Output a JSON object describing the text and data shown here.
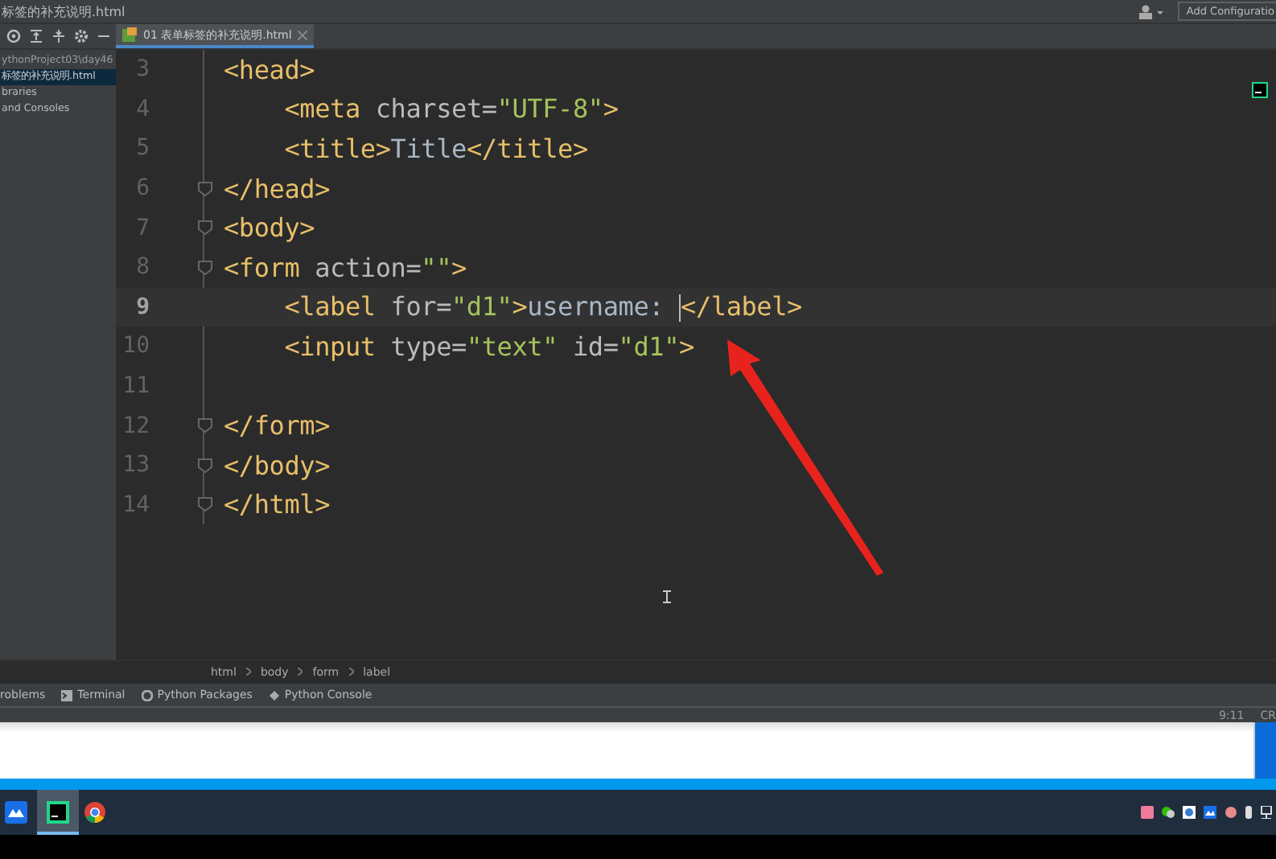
{
  "window": {
    "title": "标签的补充说明.html",
    "run_config": "Add Configuratio"
  },
  "project": {
    "path": "ythonProject03\\day46",
    "items": [
      {
        "label": "标签的补充说明.html",
        "selected": true
      },
      {
        "label": "braries",
        "selected": false
      },
      {
        "label": "and Consoles",
        "selected": false
      }
    ]
  },
  "tabs": [
    {
      "label": "01 表单标签的补充说明.html",
      "selected": true
    }
  ],
  "editor": {
    "lines": [
      {
        "number": "3",
        "fold": false,
        "current": false,
        "tokens": [
          {
            "kind": "tag",
            "text": "<head>"
          }
        ]
      },
      {
        "number": "4",
        "fold": false,
        "current": false,
        "tokens": [
          {
            "kind": "tag",
            "text": "    <meta "
          },
          {
            "kind": "attr",
            "text": "charset="
          },
          {
            "kind": "value",
            "text": "\"UTF-8\""
          },
          {
            "kind": "tag",
            "text": ">"
          }
        ]
      },
      {
        "number": "5",
        "fold": false,
        "current": false,
        "tokens": [
          {
            "kind": "tag",
            "text": "    <title>"
          },
          {
            "kind": "text",
            "text": "Title"
          },
          {
            "kind": "tag",
            "text": "</title>"
          }
        ]
      },
      {
        "number": "6",
        "fold": true,
        "current": false,
        "tokens": [
          {
            "kind": "tag",
            "text": "</head>"
          }
        ]
      },
      {
        "number": "7",
        "fold": true,
        "current": false,
        "tokens": [
          {
            "kind": "tag",
            "text": "<body>"
          }
        ]
      },
      {
        "number": "8",
        "fold": true,
        "current": false,
        "tokens": [
          {
            "kind": "tag",
            "text": "<form "
          },
          {
            "kind": "attr",
            "text": "action="
          },
          {
            "kind": "value",
            "text": "\"\""
          },
          {
            "kind": "tag",
            "text": ">"
          }
        ]
      },
      {
        "number": "9",
        "fold": false,
        "current": true,
        "tokens": [
          {
            "kind": "tag",
            "text": "    <label "
          },
          {
            "kind": "attr",
            "text": "for="
          },
          {
            "kind": "value",
            "text": "\"d1\""
          },
          {
            "kind": "tag",
            "text": ">"
          },
          {
            "kind": "text",
            "text": "username: ",
            "caret_after": true
          },
          {
            "kind": "tag",
            "text": "</label>"
          }
        ]
      },
      {
        "number": "10",
        "fold": false,
        "current": false,
        "tokens": [
          {
            "kind": "tag",
            "text": "    <input "
          },
          {
            "kind": "attr",
            "text": "type="
          },
          {
            "kind": "value",
            "text": "\"text\" "
          },
          {
            "kind": "attr",
            "text": "id="
          },
          {
            "kind": "value",
            "text": "\"d1\""
          },
          {
            "kind": "tag",
            "text": ">"
          }
        ]
      },
      {
        "number": "11",
        "fold": false,
        "current": false
      },
      {
        "number": "12",
        "fold": true,
        "current": false,
        "tokens": [
          {
            "kind": "tag",
            "text": "</form>"
          }
        ]
      },
      {
        "number": "13",
        "fold": true,
        "current": false,
        "tokens": [
          {
            "kind": "tag",
            "text": "</body>"
          }
        ]
      },
      {
        "number": "14",
        "fold": true,
        "current": false,
        "tokens": [
          {
            "kind": "tag",
            "text": "</html>"
          }
        ]
      }
    ]
  },
  "breadcrumbs": [
    "html",
    "body",
    "form",
    "label"
  ],
  "tool_tabs": [
    {
      "label": "roblems",
      "kind": "plain"
    },
    {
      "label": "Terminal",
      "kind": "terminal"
    },
    {
      "label": "Python Packages",
      "kind": "packages"
    },
    {
      "label": "Python Console",
      "kind": "console"
    }
  ],
  "status_bar": {
    "position": "9:11",
    "line_ending": "CR"
  }
}
